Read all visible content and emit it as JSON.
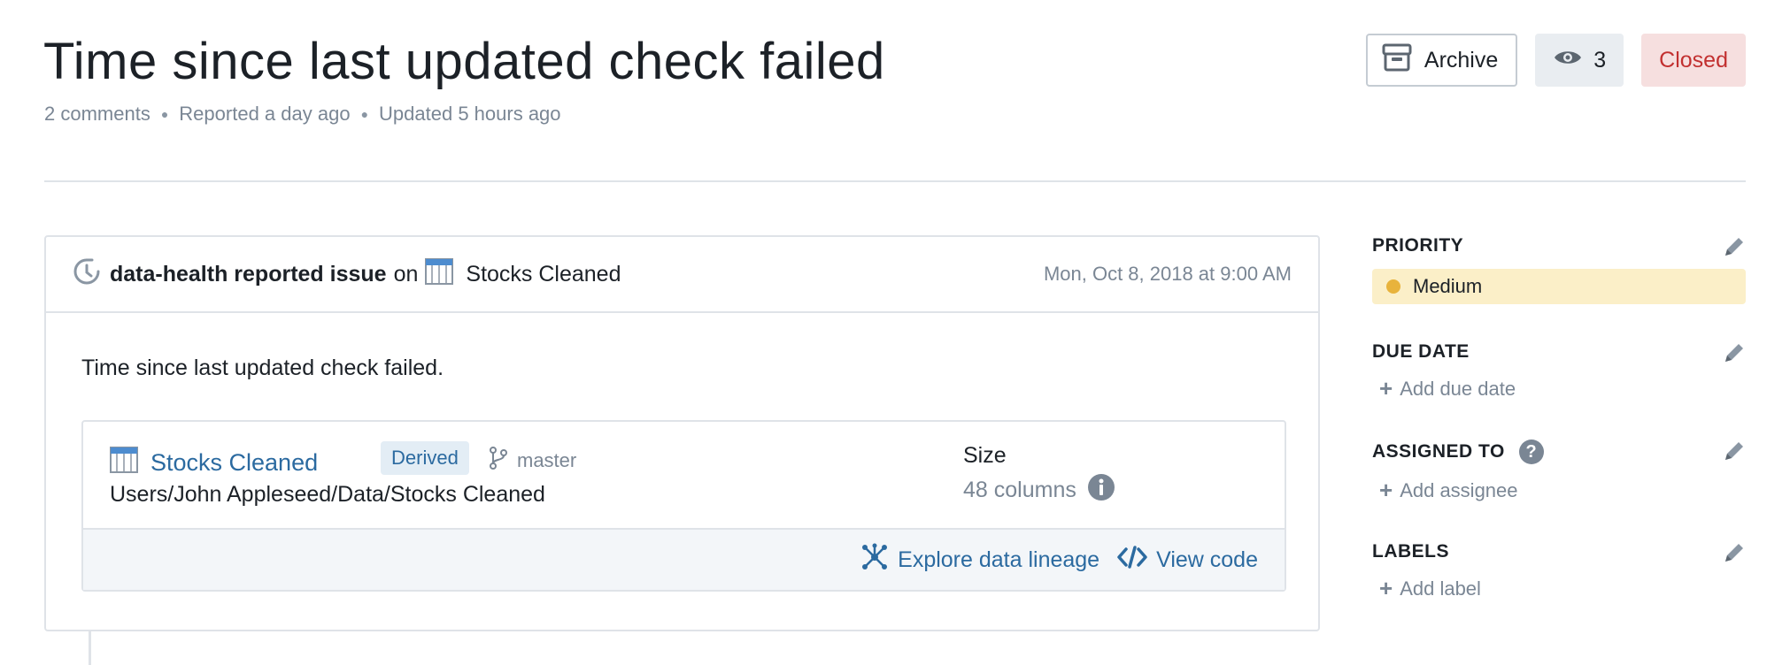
{
  "issue": {
    "title": "Time since last updated check failed",
    "comments": "2 comments",
    "reported": "Reported a day ago",
    "updated": "Updated 5 hours ago"
  },
  "actions": {
    "archive_label": "Archive",
    "watch_count": "3",
    "status_label": "Closed"
  },
  "event": {
    "actor": "data-health reported issue",
    "on": "on",
    "dataset": "Stocks Cleaned",
    "timestamp": "Mon, Oct 8, 2018 at 9:00 AM",
    "description": "Time since last updated check failed."
  },
  "dataset_card": {
    "name": "Stocks Cleaned",
    "badge": "Derived",
    "branch": "master",
    "path": "Users/John Appleseed/Data/Stocks Cleaned",
    "size_label": "Size",
    "size_value": "48 columns",
    "lineage_link": "Explore data lineage",
    "code_link": "View code"
  },
  "sidebar": {
    "priority": {
      "title": "PRIORITY",
      "value": "Medium"
    },
    "due_date": {
      "title": "DUE DATE",
      "add_label": "Add due date"
    },
    "assigned": {
      "title": "ASSIGNED TO",
      "add_label": "Add assignee"
    },
    "labels": {
      "title": "LABELS",
      "add_label": "Add label"
    }
  },
  "colors": {
    "link": "#2b6aa0",
    "closed_bg": "#f6dfdf",
    "closed_text": "#c23030",
    "priority_bg": "#fbefc8",
    "priority_dot": "#e8b33c"
  }
}
